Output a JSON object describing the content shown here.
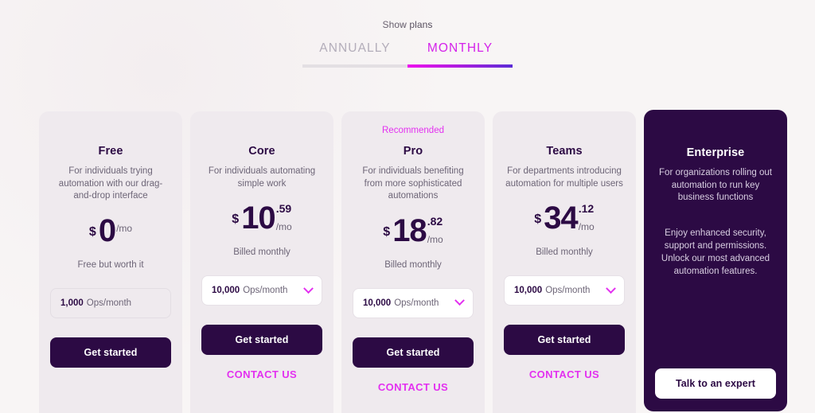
{
  "header": {
    "show_plans_label": "Show plans",
    "tabs": [
      {
        "label": "ANNUALLY",
        "active": false
      },
      {
        "label": "MONTHLY",
        "active": true
      }
    ]
  },
  "colors": {
    "page_bg": "#f8f5f5",
    "card_bg": "#efeaee",
    "dark_purple": "#2c0a44",
    "magenta": "#e331f0",
    "violet": "#5b2bd6",
    "muted_text": "#6d6577",
    "inactive_tab": "#b3adba"
  },
  "plans": [
    {
      "badge": "",
      "name": "Free",
      "description": "For individuals trying automation with our drag-and-drop interface",
      "currency": "$",
      "amount": "0",
      "cents": "",
      "per": "/mo",
      "billing_note": "Free but worth it",
      "ops_value": "1,000",
      "ops_label": "Ops/month",
      "ops_has_chevron": false,
      "cta_label": "Get started",
      "contact_label": ""
    },
    {
      "badge": "",
      "name": "Core",
      "description": "For individuals automating simple work",
      "currency": "$",
      "amount": "10",
      "cents": ".59",
      "per": "/mo",
      "billing_note": "Billed monthly",
      "ops_value": "10,000",
      "ops_label": "Ops/month",
      "ops_has_chevron": true,
      "cta_label": "Get started",
      "contact_label": "CONTACT US"
    },
    {
      "badge": "Recommended",
      "name": "Pro",
      "description": "For individuals benefiting from more sophisticated automations",
      "currency": "$",
      "amount": "18",
      "cents": ".82",
      "per": "/mo",
      "billing_note": "Billed monthly",
      "ops_value": "10,000",
      "ops_label": "Ops/month",
      "ops_has_chevron": true,
      "cta_label": "Get started",
      "contact_label": "CONTACT US"
    },
    {
      "badge": "",
      "name": "Teams",
      "description": "For departments introducing automation for multiple users",
      "currency": "$",
      "amount": "34",
      "cents": ".12",
      "per": "/mo",
      "billing_note": "Billed monthly",
      "ops_value": "10,000",
      "ops_label": "Ops/month",
      "ops_has_chevron": true,
      "cta_label": "Get started",
      "contact_label": "CONTACT US"
    }
  ],
  "enterprise": {
    "name": "Enterprise",
    "description": "For organizations rolling out automation to run key business functions",
    "extra": "Enjoy enhanced security, support and permissions. Unlock our most advanced automation features.",
    "cta_label": "Talk to an expert"
  }
}
